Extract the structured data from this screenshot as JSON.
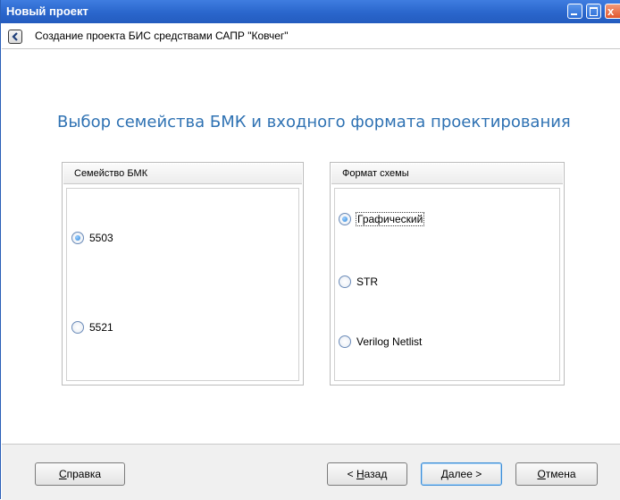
{
  "window": {
    "title": "Новый проект",
    "close_glyph": "x"
  },
  "header": {
    "title": "Создание проекта БИС средствами САПР \"Ковчег\""
  },
  "step_title": "Выбор семейства БМК и входного формата проектирования",
  "family_group": {
    "title": "Семейство БМК",
    "options": [
      {
        "label": "5503",
        "selected": true
      },
      {
        "label": "5521",
        "selected": false
      }
    ]
  },
  "format_group": {
    "title": "Формат схемы",
    "options": [
      {
        "label": "Графический",
        "selected": true
      },
      {
        "label": "STR",
        "selected": false
      },
      {
        "label": "Verilog Netlist",
        "selected": false
      }
    ]
  },
  "buttons": {
    "help": {
      "mnemonic": "С",
      "rest": "правка"
    },
    "back": {
      "prefix": "< ",
      "mnemonic": "Н",
      "rest": "азад"
    },
    "next": {
      "mnemonic": "Д",
      "rest": "алее >"
    },
    "cancel": {
      "mnemonic": "О",
      "rest": "тмена"
    }
  },
  "colors": {
    "titlebar": "#2a66cc",
    "accent_title": "#2f72b3",
    "radio_selected": "#2f86d8"
  }
}
